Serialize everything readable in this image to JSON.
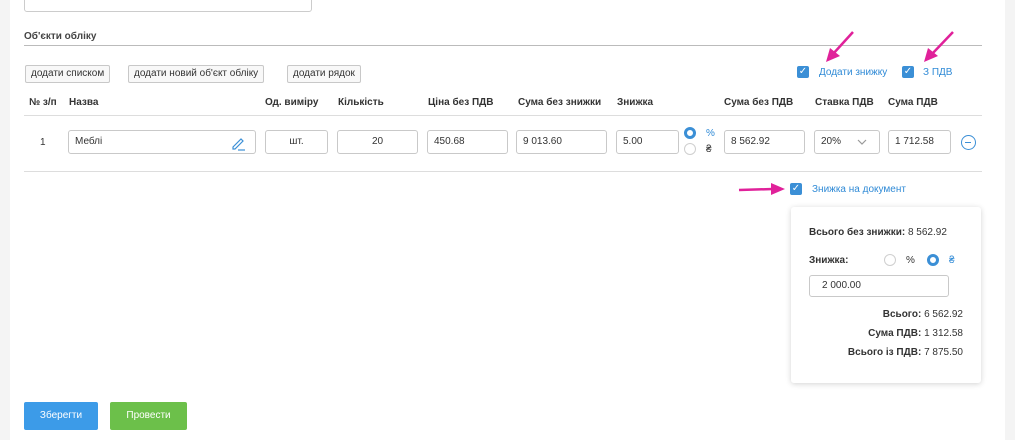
{
  "section": {
    "title": "Об'єкти обліку"
  },
  "toolbar": {
    "add_list": "додати списком",
    "add_new_object": "додати новий об'єкт обліку",
    "add_row": "додати рядок",
    "add_discount_label": "Додати знижку",
    "add_discount_checked": true,
    "with_vat_label": "З ПДВ",
    "with_vat_checked": true
  },
  "table": {
    "headers": {
      "num": "№ з/п",
      "name": "Назва",
      "unit": "Од. виміру",
      "qty": "Кількість",
      "price": "Ціна без ПДВ",
      "sum_no_discount": "Сума без знижки",
      "discount": "Знижка",
      "sum_no_vat": "Сума без ПДВ",
      "vat_rate": "Ставка ПДВ",
      "vat_sum": "Сума ПДВ"
    },
    "rows": [
      {
        "num": "1",
        "name": "Меблі",
        "unit": "шт.",
        "qty": "20",
        "price": "450.68",
        "sum_no_discount": "9 013.60",
        "discount": "5.00",
        "discount_percent_symbol": "%",
        "discount_currency_symbol": "₴",
        "discount_mode": "percent",
        "sum_no_vat": "8 562.92",
        "vat_rate": "20%",
        "vat_sum": "1 712.58"
      }
    ]
  },
  "doc_discount": {
    "label": "Знижка на документ",
    "checked": true
  },
  "summary": {
    "total_no_discount_label": "Всього без знижки:",
    "total_no_discount_value": "8 562.92",
    "discount_label": "Знижка:",
    "percent_symbol": "%",
    "currency_symbol": "₴",
    "discount_mode": "currency",
    "discount_value": "2 000.00",
    "total_label": "Всього:",
    "total_value": "6 562.92",
    "vat_label": "Сума ПДВ:",
    "vat_value": "1 312.58",
    "total_with_vat_label": "Всього із ПДВ:",
    "total_with_vat_value": "7 875.50"
  },
  "actions": {
    "save": "Зберегти",
    "post": "Провести"
  },
  "colors": {
    "accent": "#3b8fd6",
    "save": "#3c9be8",
    "post": "#6cc04a",
    "annotation_arrow": "#e0219a"
  },
  "icons": {
    "edit": "pencil-icon",
    "remove": "minus-circle-icon",
    "select": "chevron-down-icon",
    "check": "checkmark-icon"
  }
}
